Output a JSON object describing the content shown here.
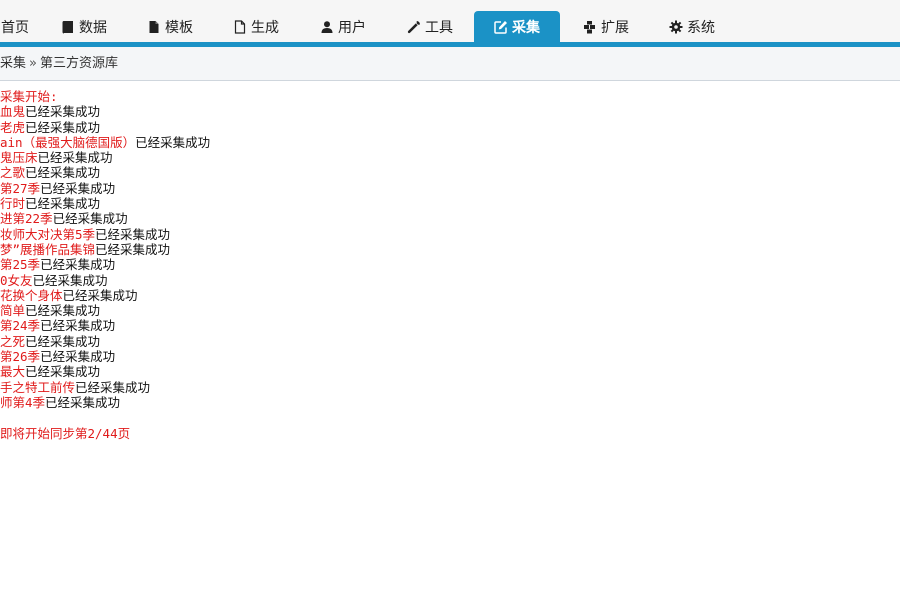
{
  "nav": {
    "tabs": [
      {
        "label": "首页",
        "icon": "home-icon"
      },
      {
        "label": "数据",
        "icon": "book-icon"
      },
      {
        "label": "模板",
        "icon": "file-icon"
      },
      {
        "label": "生成",
        "icon": "file-outline-icon"
      },
      {
        "label": "用户",
        "icon": "user-icon"
      },
      {
        "label": "工具",
        "icon": "wrench-icon"
      },
      {
        "label": "采集",
        "icon": "edit-icon",
        "active": true
      },
      {
        "label": "扩展",
        "icon": "puzzle-icon"
      },
      {
        "label": "系统",
        "icon": "gear-icon"
      }
    ],
    "accent": "#1b92c6"
  },
  "breadcrumb": {
    "items": [
      "采集",
      "第三方资源库"
    ],
    "separator": "»"
  },
  "log": {
    "header": "采集开始:",
    "entries": [
      {
        "title": "血鬼",
        "status": "已经采集成功"
      },
      {
        "title": "老虎",
        "status": "已经采集成功"
      },
      {
        "title": "ain（最强大脑德国版）",
        "status": "已经采集成功"
      },
      {
        "title": "鬼压床",
        "status": "已经采集成功"
      },
      {
        "title": "之歌",
        "status": "已经采集成功"
      },
      {
        "title": "第27季",
        "status": "已经采集成功"
      },
      {
        "title": "行时",
        "status": "已经采集成功"
      },
      {
        "title": "进第22季",
        "status": "已经采集成功"
      },
      {
        "title": "妆师大对决第5季",
        "status": "已经采集成功"
      },
      {
        "title": "梦”展播作品集锦",
        "status": "已经采集成功"
      },
      {
        "title": "第25季",
        "status": "已经采集成功"
      },
      {
        "title": "0女友",
        "status": "已经采集成功"
      },
      {
        "title": "花换个身体",
        "status": "已经采集成功"
      },
      {
        "title": "简单",
        "status": "已经采集成功"
      },
      {
        "title": "第24季",
        "status": "已经采集成功"
      },
      {
        "title": "之死",
        "status": "已经采集成功"
      },
      {
        "title": "第26季",
        "status": "已经采集成功"
      },
      {
        "title": "最大",
        "status": "已经采集成功"
      },
      {
        "title": "手之特工前传",
        "status": "已经采集成功"
      },
      {
        "title": "师第4季",
        "status": "已经采集成功"
      }
    ],
    "footer": "即将开始同步第2/44页",
    "title_color": "#e01b1b"
  }
}
